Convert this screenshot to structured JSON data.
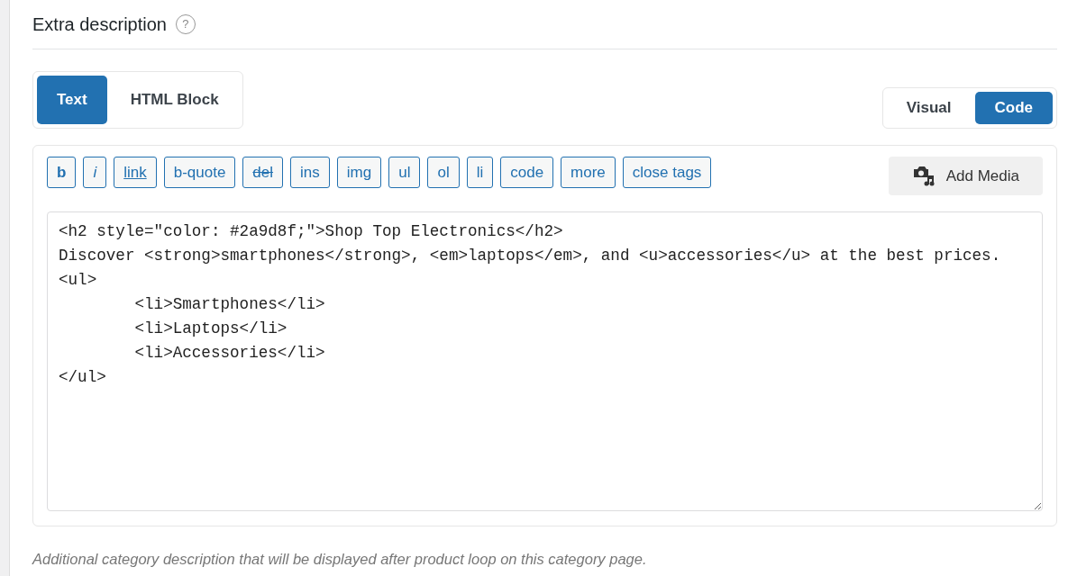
{
  "section": {
    "title": "Extra description",
    "help_icon": "?"
  },
  "content_tabs": [
    {
      "label": "Text",
      "selected": true
    },
    {
      "label": "HTML Block",
      "selected": false
    }
  ],
  "editor_tabs": [
    {
      "label": "Visual",
      "selected": false
    },
    {
      "label": "Code",
      "selected": true
    }
  ],
  "toolbar": [
    {
      "label": "b",
      "kind": "bold"
    },
    {
      "label": "i",
      "kind": "italic"
    },
    {
      "label": "link",
      "kind": "underline"
    },
    {
      "label": "b-quote",
      "kind": "plain"
    },
    {
      "label": "del",
      "kind": "strike"
    },
    {
      "label": "ins",
      "kind": "plain"
    },
    {
      "label": "img",
      "kind": "plain"
    },
    {
      "label": "ul",
      "kind": "plain"
    },
    {
      "label": "ol",
      "kind": "plain"
    },
    {
      "label": "li",
      "kind": "plain"
    },
    {
      "label": "code",
      "kind": "plain"
    },
    {
      "label": "more",
      "kind": "plain"
    },
    {
      "label": "close tags",
      "kind": "plain"
    }
  ],
  "add_media": {
    "label": "Add Media"
  },
  "code": "<h2 style=\"color: #2a9d8f;\">Shop Top Electronics</h2>\nDiscover <strong>smartphones</strong>, <em>laptops</em>, and <u>accessories</u> at the best prices.\n<ul>\n\t<li>Smartphones</li>\n\t<li>Laptops</li>\n\t<li>Accessories</li>\n</ul>",
  "description": "Additional category description that will be displayed after product loop on this category page."
}
